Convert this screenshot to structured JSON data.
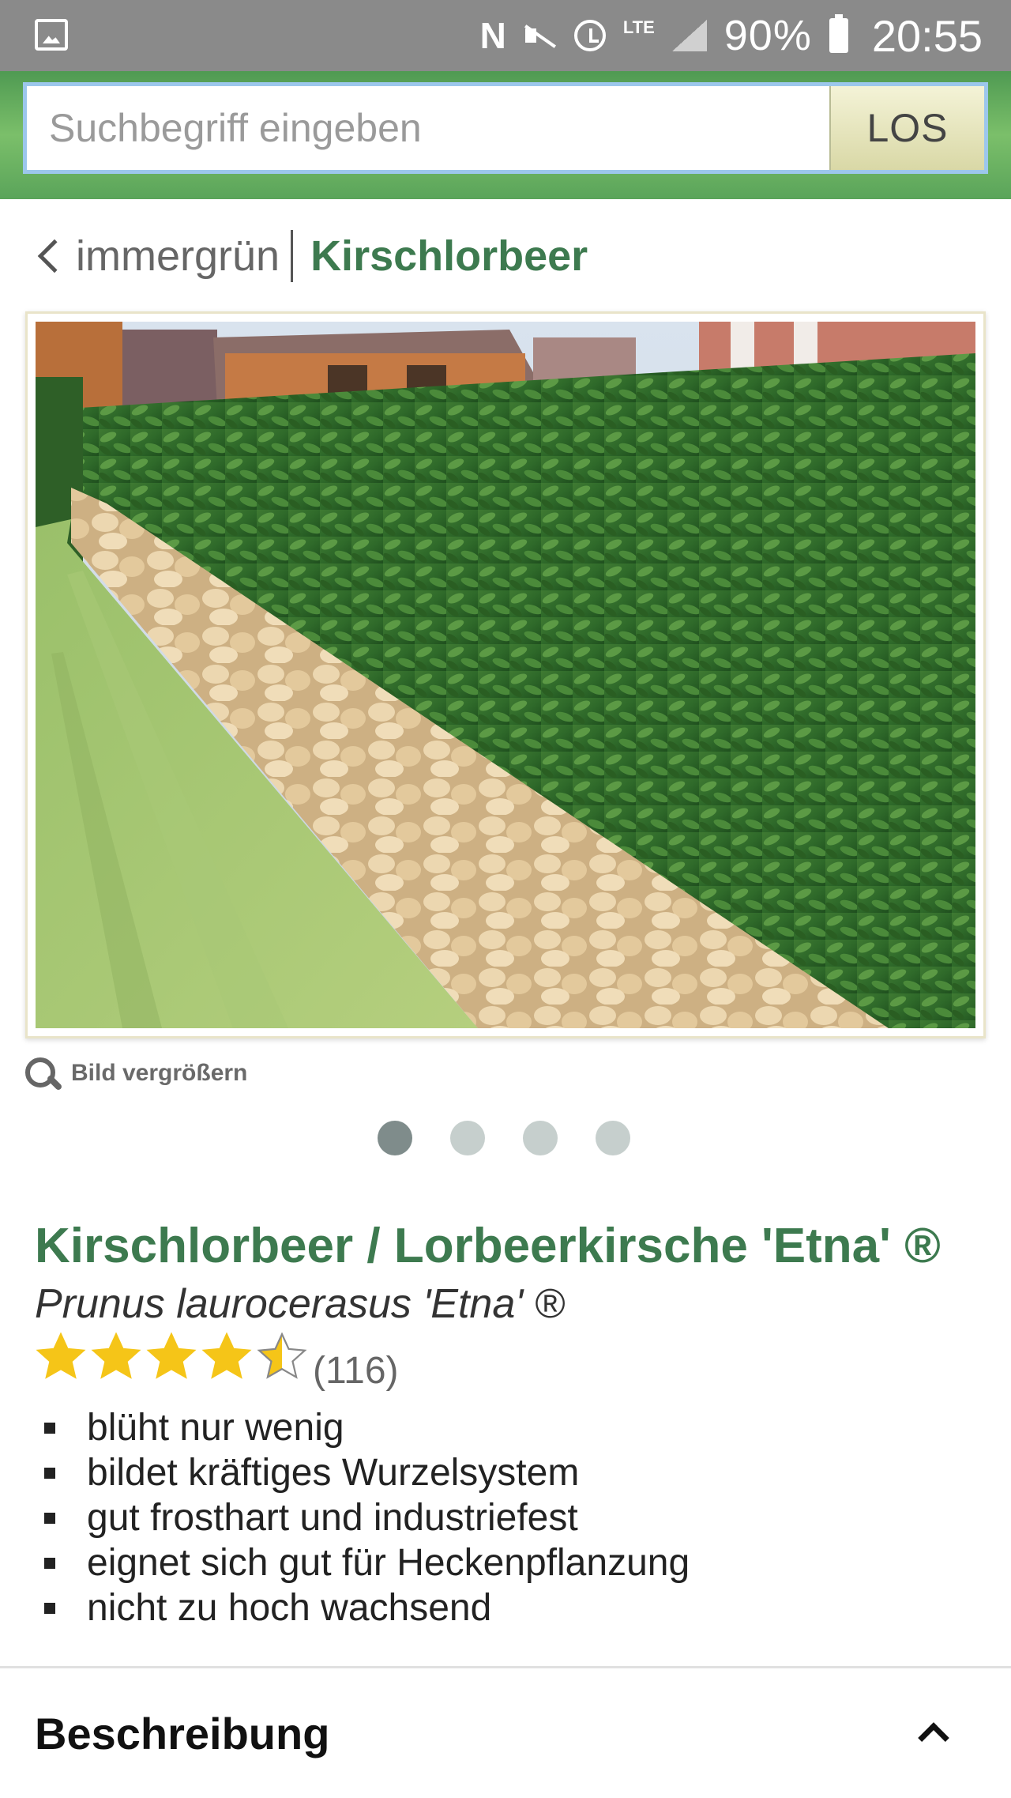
{
  "status_bar": {
    "icons": [
      "gallery-icon",
      "nfc-icon",
      "mute-icon",
      "alarm-icon",
      "lte-icon",
      "signal-icon",
      "battery-icon"
    ],
    "nfc": "N",
    "network": "LTE",
    "battery": "90%",
    "time": "20:55"
  },
  "search": {
    "placeholder": "Suchbegriff eingeben",
    "value": "",
    "button_label": "LOS"
  },
  "breadcrumb": {
    "parent": "immergrün",
    "current": "Kirschlorbeer"
  },
  "gallery": {
    "zoom_label": "Bild vergrößern",
    "slide_count": 4,
    "active_slide": 1
  },
  "product": {
    "title": "Kirschlorbeer / Lorbeerkirsche 'Etna' ®",
    "latin_name": "Prunus laurocerasus 'Etna' ®",
    "rating": 4.5,
    "rating_max": 5,
    "review_count": "(116)",
    "features": [
      "blüht nur wenig",
      "bildet kräftiges Wurzelsystem",
      "gut frosthart und industriefest",
      "eignet sich gut für Heckenpflanzung",
      "nicht zu hoch wachsend"
    ]
  },
  "description": {
    "title": "Beschreibung"
  },
  "colors": {
    "brand_green": "#3d7a4f",
    "search_band": "#5aa45a",
    "star": "#f5c518",
    "status_bar": "#8a8a8a"
  }
}
